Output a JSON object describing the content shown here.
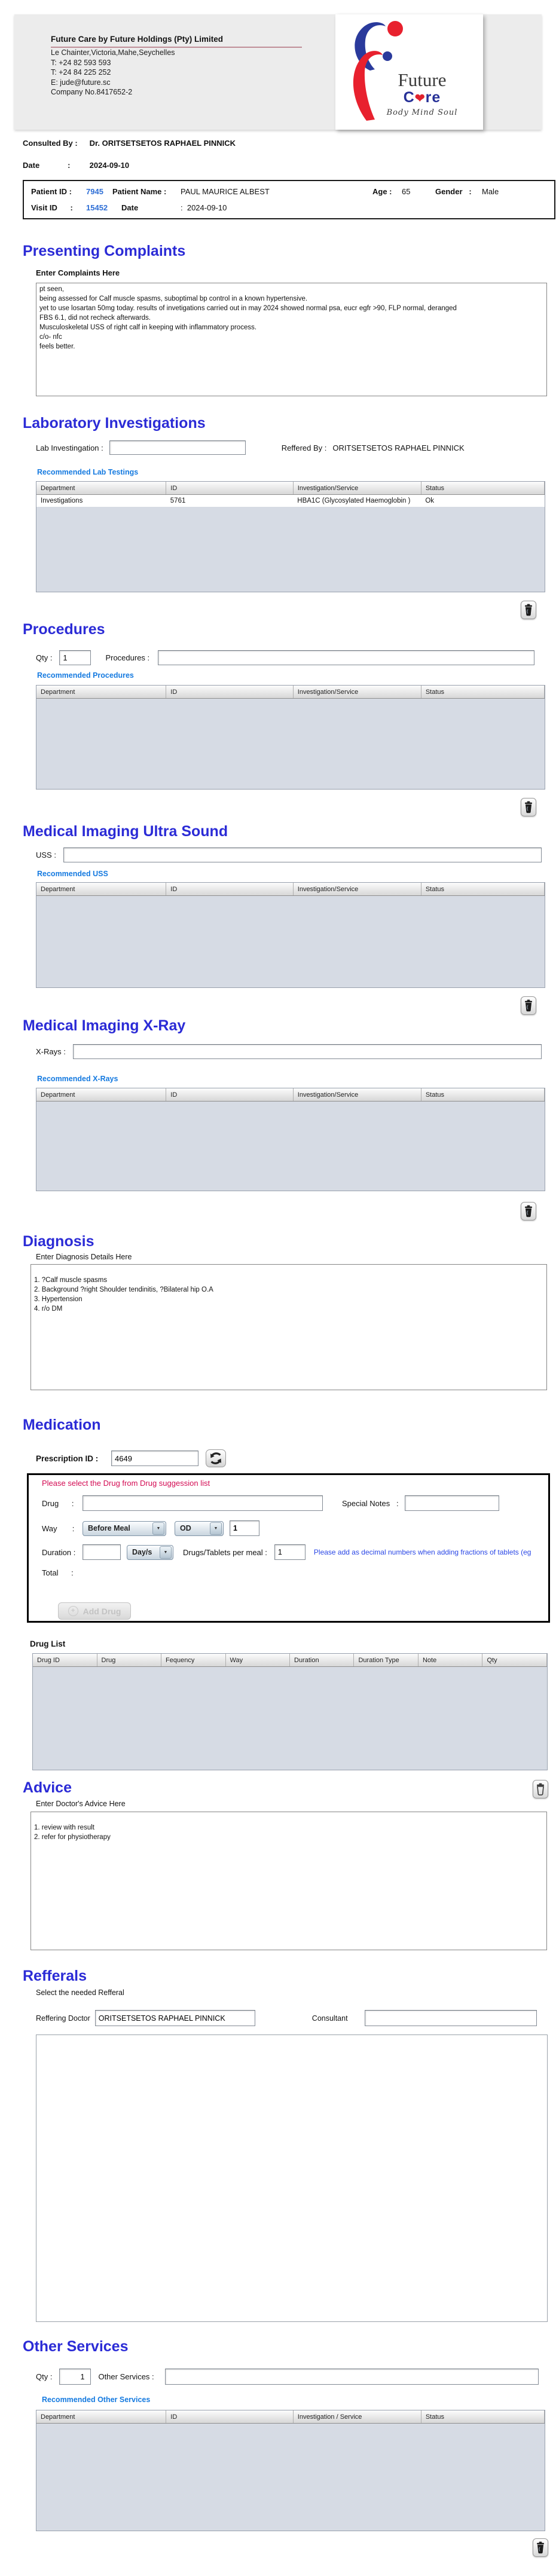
{
  "colors": {
    "heading": "#2b2bd6",
    "link": "#157ae0",
    "alert": "#d30a52",
    "info": "#2946e6",
    "id_value": "#2f6fd6"
  },
  "letterhead": {
    "company_name": "Future Care by Future Holdings (Pty) Limited",
    "address_lines": [
      "Le Chainter,Victoria,Mahe,Seychelles",
      "T: +24  82 593 593",
      "T: +24  84 225 252",
      "E: jude@future.sc",
      "Company No.8417652-2"
    ],
    "logo": {
      "word_top": "Future",
      "care_pre": "C",
      "care_post": "re",
      "tagline": "Body Mind Soul"
    }
  },
  "consultation": {
    "consulted_by_label": "Consulted By :",
    "consulted_by_value": "Dr.  ORITSETSETOS RAPHAEL PINNICK",
    "date_label": "Date             :",
    "date_value": "2024-09-10"
  },
  "patient": {
    "patient_id_label": "Patient ID :",
    "patient_id": "7945",
    "name_label": "Patient Name :",
    "name": "PAUL MAURICE ALBEST",
    "age_label": "Age :",
    "age": "65",
    "gender_label": "Gender   :",
    "gender": "Male",
    "visit_id_label": "Visit ID      :",
    "visit_id": "15452",
    "visit_date_label": "Date",
    "visit_date": ":  2024-09-10"
  },
  "complaints": {
    "title": "Presenting Complaints",
    "label": "Enter Complaints Here",
    "text": "pt seen,\nbeing assessed for Calf muscle spasms, suboptimal bp control in a known hypertensive.\nyet to use losartan 50mg today. results of invetigations carried out in may 2024 showed normal psa, eucr egfr >90, FLP normal, deranged\nFBS 6.1, did not recheck afterwards.\nMusculoskeletal USS of right calf in keeping with inflammatory process.\nc/o- nfc\nfeels better."
  },
  "laboratory": {
    "title": "Laboratory  Investigations",
    "field_label": "Lab Investingation :",
    "field_value": "",
    "referred_by_label": "Reffered By :",
    "referred_by": "ORITSETSETOS RAPHAEL PINNICK",
    "recommended": "Recommended Lab Testings",
    "headers": [
      "Department",
      "ID",
      "Investigation/Service",
      "Status"
    ],
    "rows": [
      [
        "Investigations",
        "5761",
        "HBA1C (Glycosylated Haemoglobin )",
        "Ok"
      ]
    ]
  },
  "procedures": {
    "title": "Procedures",
    "qty_label": "Qty :",
    "qty": "1",
    "field_label": "Procedures :",
    "field_value": "",
    "recommended": "Recommended Procedures",
    "headers": [
      "Department",
      "ID",
      "Investigation/Service",
      "Status"
    ],
    "rows": []
  },
  "uss": {
    "title": "Medical Imaging Ultra Sound",
    "field_label": "USS :",
    "field_value": "",
    "recommended": "Recommended USS",
    "headers": [
      "Department",
      "ID",
      "Investigation/Service",
      "Status"
    ],
    "rows": []
  },
  "xray": {
    "title": "Medical Imaging X-Ray",
    "field_label": "X-Rays :",
    "field_value": "",
    "recommended": "Recommended X-Rays",
    "headers": [
      "Department",
      "ID",
      "Investigation/Service",
      "Status"
    ],
    "rows": []
  },
  "diagnosis": {
    "title": "Diagnosis",
    "label": "Enter Diagnosis Details Here",
    "text": "\n1. ?Calf muscle spasms\n2. Background ?right Shoulder tendinitis, ?Bilateral hip O.A\n3. Hypertension\n4. r/o DM"
  },
  "medication": {
    "title": "Medication",
    "prescription_label": "Prescription ID :",
    "prescription_id": "4649",
    "drug_note": "Please select the Drug from Drug suggession list",
    "drug_label": "Drug      :",
    "drug_value": "",
    "special_notes_label": "Special Notes   :",
    "special_notes_value": "",
    "way_label": "Way       :",
    "way_meal": "Before Meal",
    "way_freq": "OD",
    "way_qty": "1",
    "duration_label": "Duration :",
    "duration_value": "",
    "duration_unit": "Day/s",
    "per_meal_label": "Drugs/Tablets per meal :",
    "per_meal_qty": "1",
    "fraction_note": "Please add as decimal numbers when adding fractions of tablets (eg",
    "total_label": "Total      :",
    "add_drug_label": "Add Drug",
    "drug_list_label": "Drug List",
    "headers": [
      "Drug ID",
      "Drug",
      "Fequency",
      "Way",
      "Duration",
      "Duration Type",
      "Note",
      "Qty"
    ],
    "rows": []
  },
  "advice": {
    "title": "Advice",
    "label": "Enter Doctor's Advice Here",
    "text": "\n1. review with result\n2. refer for physiotherapy"
  },
  "referrals": {
    "title": "Refferals",
    "label": "Select the needed Refferal",
    "doctor_label": "Reffering Doctor",
    "doctor": "ORITSETSETOS RAPHAEL PINNICK",
    "consultant_label": "Consultant",
    "consultant": ""
  },
  "other_services": {
    "title": "Other Services",
    "qty_label": "Qty :",
    "qty": "1",
    "field_label": "Other Services :",
    "field_value": "",
    "recommended": "Recommended Other Services",
    "headers": [
      "Department",
      "ID",
      "Investigation / Service",
      "Status"
    ],
    "rows": []
  }
}
